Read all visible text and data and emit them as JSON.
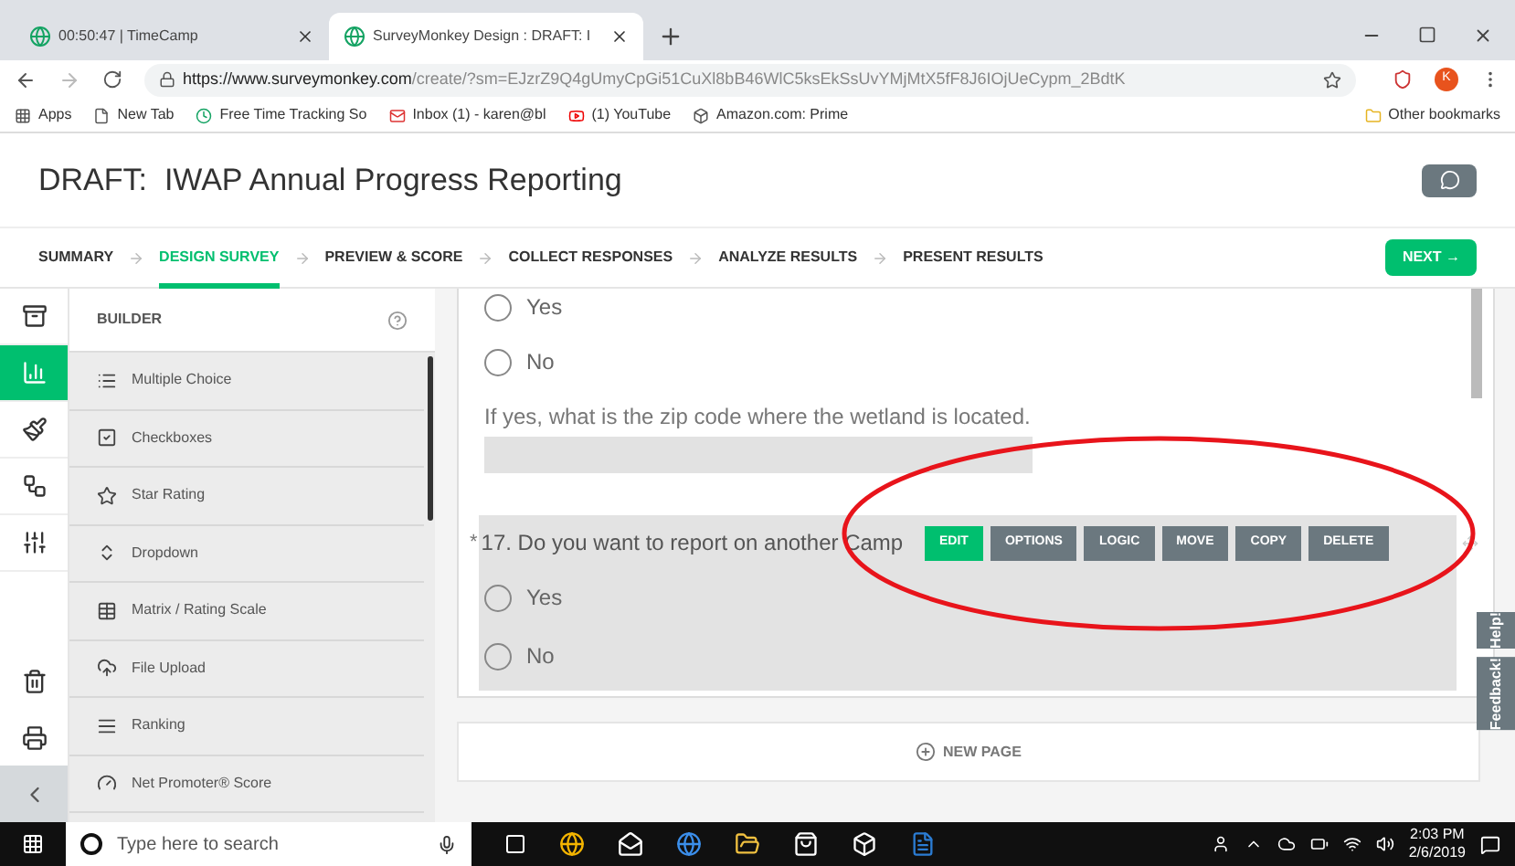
{
  "browser": {
    "tabs": [
      {
        "title": "00:50:47 | TimeCamp",
        "selected": false
      },
      {
        "title": "SurveyMonkey Design : DRAFT: I",
        "selected": true
      }
    ],
    "url_host": "https://www.surveymonkey.com",
    "url_path": "/create/?sm=EJzrZ9Q4gUmyCpGi51CuXl8bB46WlC5ksEkSsUvYMjMtX5fF8J6IOjUeCypm_2BdtK",
    "profile": "K",
    "bookmarks": [
      "Apps",
      "New Tab",
      "Free Time Tracking So",
      "Inbox (1) - karen@bl",
      "(1) YouTube",
      "Amazon.com: Prime"
    ],
    "other_bookmarks": "Other bookmarks"
  },
  "header": {
    "title": "DRAFT:  IWAP Annual Progress Reporting"
  },
  "steps": [
    {
      "label": "SUMMARY",
      "selected": false
    },
    {
      "label": "DESIGN SURVEY",
      "selected": true
    },
    {
      "label": "PREVIEW & SCORE",
      "selected": false
    },
    {
      "label": "COLLECT RESPONSES",
      "selected": false
    },
    {
      "label": "ANALYZE RESULTS",
      "selected": false
    },
    {
      "label": "PRESENT RESULTS",
      "selected": false
    }
  ],
  "next_button": "NEXT →",
  "rail": [
    {
      "selected": false
    },
    {
      "selected": true
    },
    {
      "selected": false
    },
    {
      "selected": false
    },
    {
      "selected": false
    }
  ],
  "builder": {
    "title": "BUILDER",
    "items": [
      "Multiple Choice",
      "Checkboxes",
      "Star Rating",
      "Dropdown",
      "Matrix / Rating Scale",
      "File Upload",
      "Ranking",
      "Net Promoter® Score"
    ]
  },
  "survey": {
    "prev_options": [
      {
        "label": "Yes",
        "selected": false
      },
      {
        "label": "No",
        "selected": false
      }
    ],
    "followup": "If yes, what is the zip code where the wetland is located.",
    "question": {
      "required_mark": "*",
      "text": "17. Do you want to report on another Camp",
      "options": [
        {
          "label": "Yes",
          "selected": false
        },
        {
          "label": "No",
          "selected": false
        }
      ]
    },
    "toolbar": [
      {
        "label": "EDIT",
        "kind": "primary"
      },
      {
        "label": "OPTIONS",
        "kind": "secondary"
      },
      {
        "label": "LOGIC",
        "kind": "secondary"
      },
      {
        "label": "MOVE",
        "kind": "secondary"
      },
      {
        "label": "COPY",
        "kind": "secondary"
      },
      {
        "label": "DELETE",
        "kind": "secondary"
      }
    ],
    "new_page": "NEW PAGE"
  },
  "side_tabs": [
    "Help!",
    "Feedback!"
  ],
  "taskbar": {
    "search_placeholder": "Type here to search",
    "time": "2:03 PM",
    "date": "2/6/2019"
  }
}
